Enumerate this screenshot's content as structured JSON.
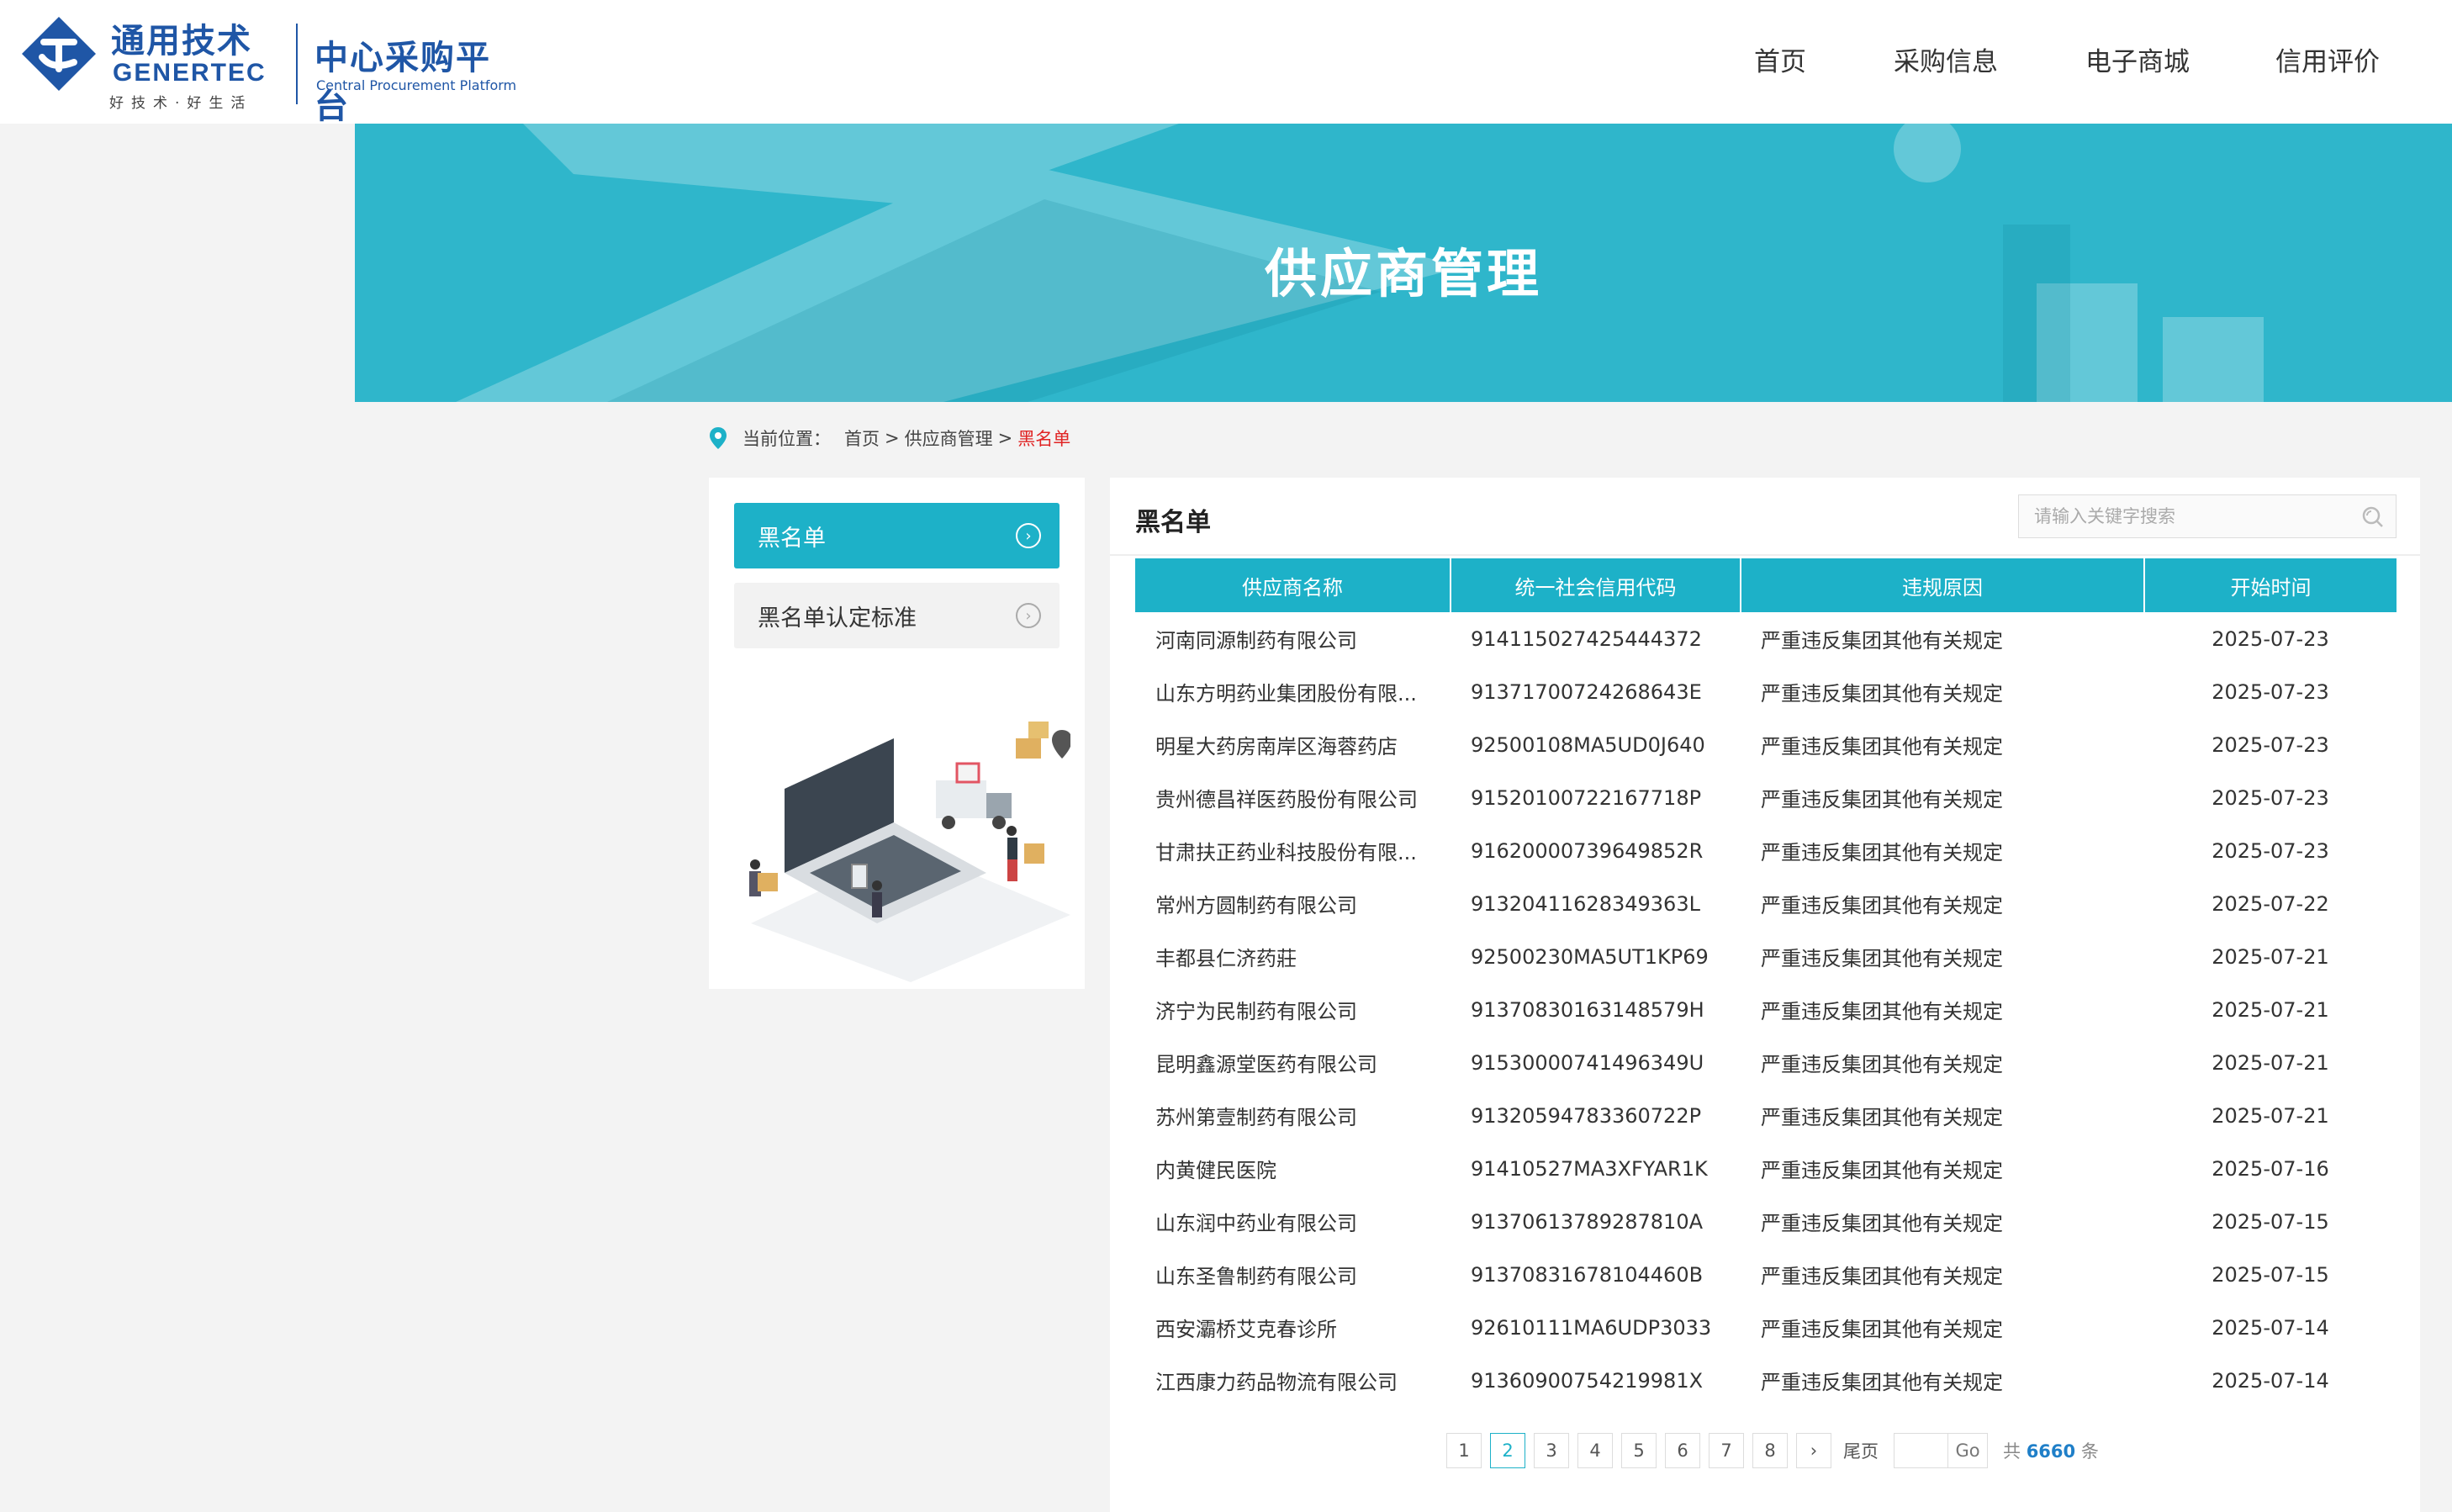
{
  "header": {
    "logo_cn": "通用技术",
    "logo_en": "GENERTEC",
    "logo_slogan": "好技术·好生活",
    "platform_cn": "中心采购平台",
    "platform_en": "Central Procurement Platform",
    "nav": [
      "首页",
      "采购信息",
      "电子商城",
      "信用评价"
    ]
  },
  "banner": {
    "title": "供应商管理"
  },
  "breadcrumb": {
    "label": "当前位置：",
    "items": [
      "首页",
      "供应商管理"
    ],
    "separator": ">",
    "current": "黑名单"
  },
  "sidebar": {
    "items": [
      {
        "label": "黑名单",
        "active": true
      },
      {
        "label": "黑名单认定标准",
        "active": false
      }
    ]
  },
  "main": {
    "title": "黑名单",
    "search_placeholder": "请输入关键字搜索",
    "columns": [
      "供应商名称",
      "统一社会信用代码",
      "违规原因",
      "开始时间"
    ],
    "rows": [
      [
        "河南同源制药有限公司",
        "914115027425444372",
        "严重违反集团其他有关规定",
        "2025-07-23"
      ],
      [
        "山东方明药业集团股份有限...",
        "91371700724268643E",
        "严重违反集团其他有关规定",
        "2025-07-23"
      ],
      [
        "明星大药房南岸区海蓉药店",
        "92500108MA5UD0J640",
        "严重违反集团其他有关规定",
        "2025-07-23"
      ],
      [
        "贵州德昌祥医药股份有限公司",
        "91520100722167718P",
        "严重违反集团其他有关规定",
        "2025-07-23"
      ],
      [
        "甘肃扶正药业科技股份有限...",
        "91620000739649852R",
        "严重违反集团其他有关规定",
        "2025-07-23"
      ],
      [
        "常州方圆制药有限公司",
        "91320411628349363L",
        "严重违反集团其他有关规定",
        "2025-07-22"
      ],
      [
        "丰都县仁济药莊",
        "92500230MA5UT1KP69",
        "严重违反集团其他有关规定",
        "2025-07-21"
      ],
      [
        "济宁为民制药有限公司",
        "91370830163148579H",
        "严重违反集团其他有关规定",
        "2025-07-21"
      ],
      [
        "昆明鑫源堂医药有限公司",
        "91530000741496349U",
        "严重违反集团其他有关规定",
        "2025-07-21"
      ],
      [
        "苏州第壹制药有限公司",
        "91320594783360722P",
        "严重违反集团其他有关规定",
        "2025-07-21"
      ],
      [
        "内黄健民医院",
        "91410527MA3XFYAR1K",
        "严重违反集团其他有关规定",
        "2025-07-16"
      ],
      [
        "山东润中药业有限公司",
        "91370613789287810A",
        "严重违反集团其他有关规定",
        "2025-07-15"
      ],
      [
        "山东圣鲁制药有限公司",
        "91370831678104460B",
        "严重违反集团其他有关规定",
        "2025-07-15"
      ],
      [
        "西安灞桥艾克春诊所",
        "92610111MA6UDP3033",
        "严重违反集团其他有关规定",
        "2025-07-14"
      ],
      [
        "江西康力药品物流有限公司",
        "91360900754219981X",
        "严重违反集团其他有关规定",
        "2025-07-14"
      ]
    ]
  },
  "pagination": {
    "pages": [
      "1",
      "2",
      "3",
      "4",
      "5",
      "6",
      "7",
      "8"
    ],
    "current": "2",
    "next": "›",
    "last": "尾页",
    "go": "Go",
    "total_prefix": "共",
    "total": "6660",
    "total_suffix": "条"
  },
  "colors": {
    "accent": "#1db1c8",
    "brand": "#1f56a6",
    "banner": "#2fb6cb",
    "highlight": "#e02424"
  }
}
